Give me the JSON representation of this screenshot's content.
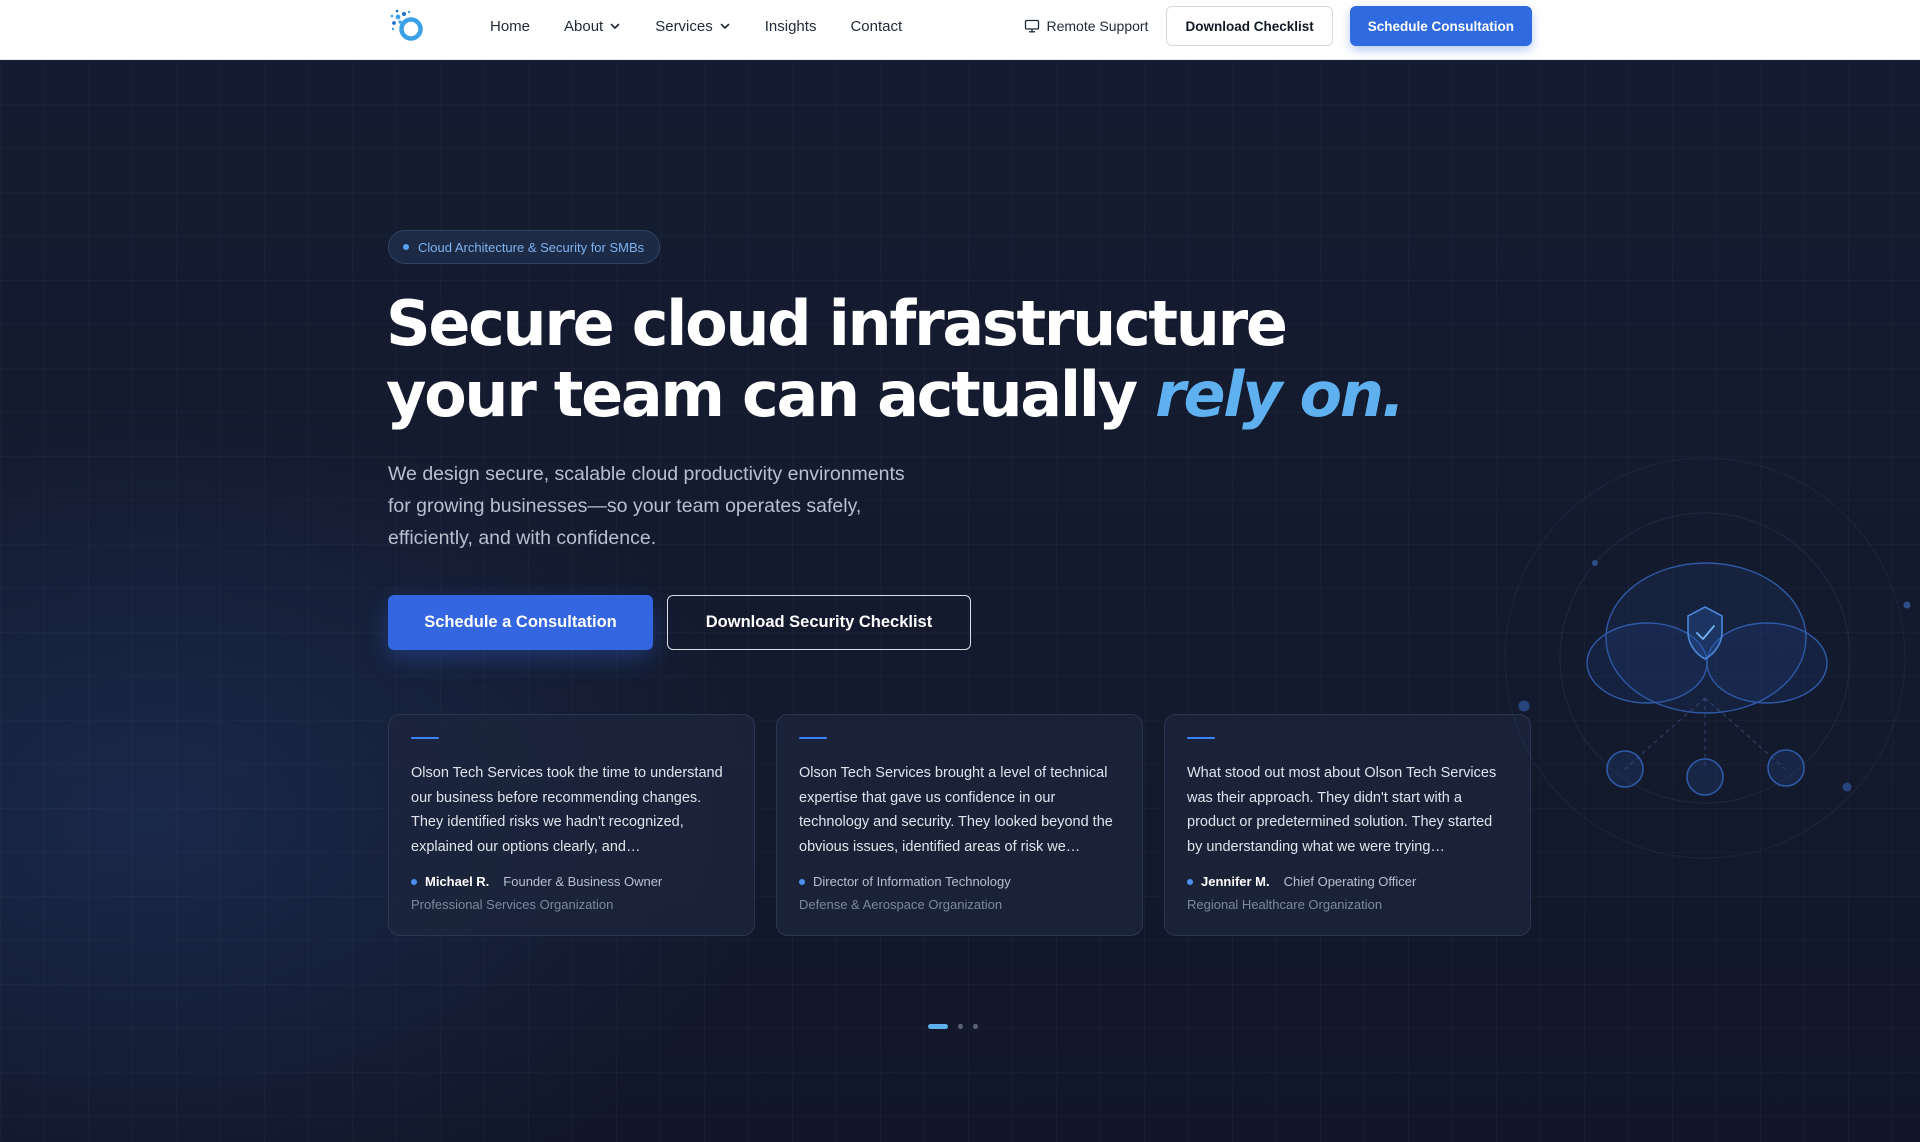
{
  "nav": {
    "menu": [
      {
        "label": "Home",
        "has_dropdown": false
      },
      {
        "label": "About",
        "has_dropdown": true
      },
      {
        "label": "Services",
        "has_dropdown": true
      },
      {
        "label": "Insights",
        "has_dropdown": false
      },
      {
        "label": "Contact",
        "has_dropdown": false
      }
    ],
    "remote_support": "Remote Support",
    "download_checklist": "Download Checklist",
    "schedule_consultation": "Schedule Consultation"
  },
  "hero": {
    "badge": "Cloud Architecture & Security for SMBs",
    "headline_line1": "Secure cloud infrastructure",
    "headline_line2": "your team can actually",
    "headline_accent": "rely on.",
    "subheadline": "We design secure, scalable cloud productivity environments for growing businesses—so your team operates safely, efficiently, and with confidence.",
    "cta_primary": "Schedule a Consultation",
    "cta_secondary": "Download Security Checklist"
  },
  "testimonials": [
    {
      "quote": "Olson Tech Services took the time to understand our business before recommending changes. They identified risks we hadn't recognized, explained our options clearly, and…",
      "name": "Michael R.",
      "role": "Founder & Business Owner",
      "org": "Professional Services Organization"
    },
    {
      "quote": "Olson Tech Services brought a level of technical expertise that gave us confidence in our technology and security. They looked beyond the obvious issues, identified areas of risk we…",
      "name": "",
      "role": "Director of Information Technology",
      "org": "Defense & Aerospace Organization"
    },
    {
      "quote": "What stood out most about Olson Tech Services was their approach. They didn't start with a product or predetermined solution. They started by understanding what we were trying…",
      "name": "Jennifer M.",
      "role": "Chief Operating Officer",
      "org": "Regional Healthcare Organization"
    }
  ],
  "carousel": {
    "pages": 3,
    "active": 1
  },
  "icons": {
    "logo": "logo-icon",
    "monitor": "monitor-icon",
    "chevron": "chevron-down-icon",
    "shield": "shield-check-icon",
    "cloud": "cloud-network-illustration"
  },
  "colors": {
    "accent": "#5fb0ef",
    "primary_button": "#3366e0",
    "background": "#121a2e"
  }
}
